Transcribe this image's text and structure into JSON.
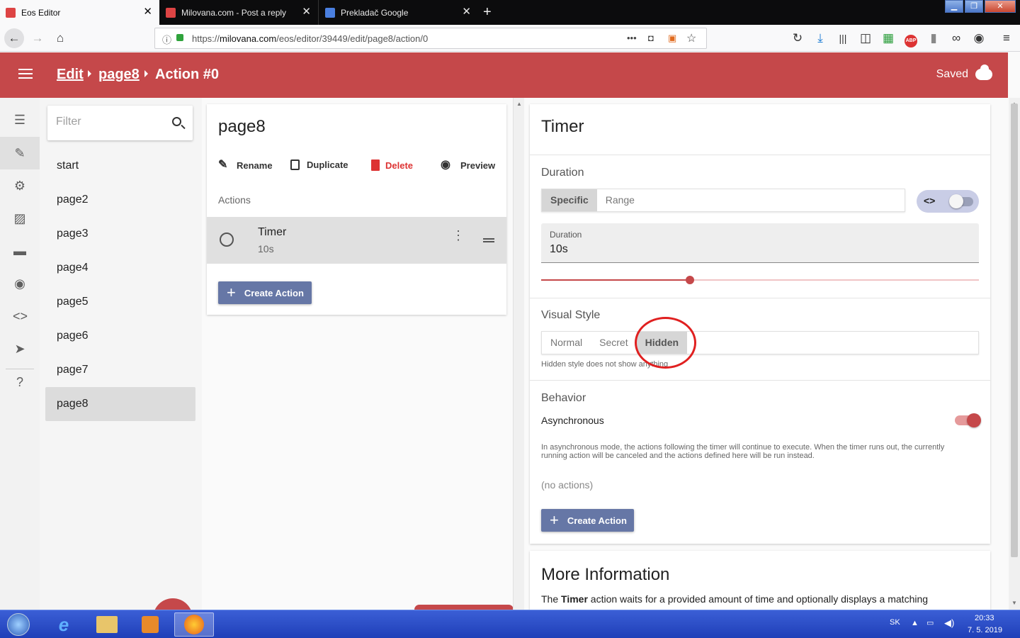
{
  "browser": {
    "tabs": [
      {
        "title": "Eos Editor",
        "active": true
      },
      {
        "title": "Milovana.com - Post a reply",
        "active": false
      },
      {
        "title": "Prekladač Google",
        "active": false
      }
    ],
    "url_prefix": "https://",
    "url_host": "milovana.com",
    "url_path": "/eos/editor/39449/edit/page8/action/0",
    "menu_dots": "•••"
  },
  "header": {
    "crumb_edit": "Edit",
    "crumb_page": "page8",
    "crumb_action": "Action #0",
    "saved_label": "Saved",
    "color": "#c5484a"
  },
  "rail": {
    "icons": [
      "list-icon",
      "pencil-icon",
      "gear-icon",
      "image-icon",
      "folder-icon",
      "eye-icon",
      "code-icon",
      "send-icon",
      "help-icon"
    ]
  },
  "pages": {
    "filter_placeholder": "Filter",
    "items": [
      "start",
      "page2",
      "page3",
      "page4",
      "page5",
      "page6",
      "page7",
      "page8"
    ],
    "selected": "page8"
  },
  "page_panel": {
    "title": "page8",
    "rename": "Rename",
    "duplicate": "Duplicate",
    "delete": "Delete",
    "preview": "Preview",
    "actions_label": "Actions",
    "action": {
      "name": "Timer",
      "value": "10s"
    },
    "create_action": "Create Action"
  },
  "timer_panel": {
    "title": "Timer",
    "duration_section": "Duration",
    "mode_specific": "Specific",
    "mode_range": "Range",
    "code_toggle": "<>",
    "duration_label": "Duration",
    "duration_value": "10s",
    "slider_fraction": 0.34,
    "visual_style_section": "Visual Style",
    "style_normal": "Normal",
    "style_secret": "Secret",
    "style_hidden": "Hidden",
    "hidden_note": "Hidden style does not show anything",
    "behavior_section": "Behavior",
    "async_label": "Asynchronous",
    "async_on": true,
    "async_note": "In asynchronous mode, the actions following the timer will continue to execute. When the timer runs out, the currently running action will be canceled and the actions defined here will be run instead.",
    "no_actions": "(no actions)",
    "create_action": "Create Action"
  },
  "more_info": {
    "title": "More Information",
    "text_pre": "The ",
    "text_bold": "Timer",
    "text_post": " action waits for a provided amount of time and optionally displays a matching"
  },
  "taskbar": {
    "lang": "SK",
    "time": "20:33",
    "date": "7. 5. 2019"
  }
}
